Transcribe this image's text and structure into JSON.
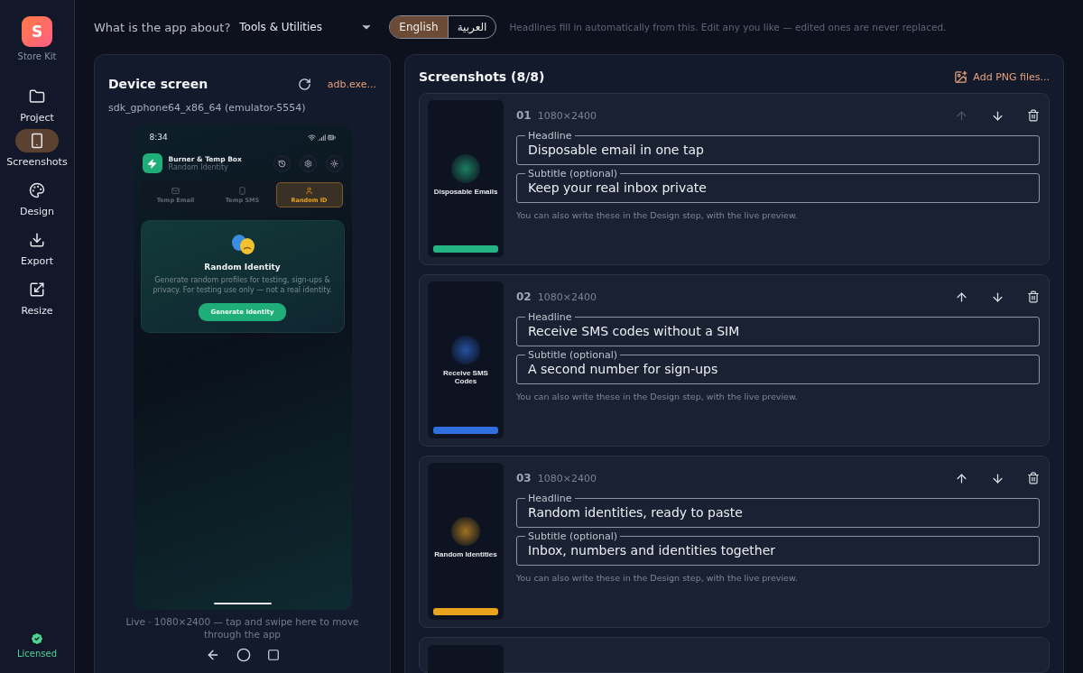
{
  "sidebar": {
    "logo_letter": "S",
    "app_name": "Store Kit",
    "items": [
      {
        "label": "Project",
        "selected": false
      },
      {
        "label": "Screenshots",
        "selected": true
      },
      {
        "label": "Design",
        "selected": false
      },
      {
        "label": "Export",
        "selected": false
      },
      {
        "label": "Resize",
        "selected": false
      }
    ],
    "license": "Licensed"
  },
  "topbar": {
    "question": "What is the app about?",
    "category": "Tools & Utilities",
    "languages": [
      {
        "label": "English",
        "selected": true
      },
      {
        "label": "العربية",
        "selected": false
      }
    ],
    "hint": "Headlines fill in automatically from this. Edit any you like — edited ones are never replaced."
  },
  "device": {
    "title": "Device screen",
    "adb": "adb.exe...",
    "device_name": "sdk_gphone64_x86_64 (emulator-5554)",
    "phone": {
      "time": "8:34",
      "app_title": "Burner & Temp Box",
      "app_subtitle": "Random Identity",
      "tabs": [
        {
          "label": "Temp Email",
          "selected": false
        },
        {
          "label": "Temp SMS",
          "selected": false
        },
        {
          "label": "Random ID",
          "selected": true
        }
      ],
      "card_title": "Random Identity",
      "card_text": "Generate random profiles for testing, sign-ups & privacy. For testing use only — not a real identity.",
      "card_button": "Generate Identity"
    },
    "caption": "Live · 1080×2400 — tap and swipe here to move through the app"
  },
  "screenshots": {
    "title": "Screenshots (8/8)",
    "add_button": "Add PNG files...",
    "items": [
      {
        "number": "01",
        "size": "1080×2400",
        "thumb_title": "Disposable Emails",
        "up_disabled": true,
        "headline_label": "Headline",
        "headline": "Disposable email in one tap",
        "subtitle_label": "Subtitle (optional)",
        "subtitle": "Keep your real inbox private",
        "note": "You can also write these in the Design step, with the live preview."
      },
      {
        "number": "02",
        "size": "1080×2400",
        "thumb_title": "Receive SMS Codes",
        "up_disabled": false,
        "headline_label": "Headline",
        "headline": "Receive SMS codes without a SIM",
        "subtitle_label": "Subtitle (optional)",
        "subtitle": "A second number for sign-ups",
        "note": "You can also write these in the Design step, with the live preview."
      },
      {
        "number": "03",
        "size": "1080×2400",
        "thumb_title": "Random Identities",
        "up_disabled": false,
        "headline_label": "Headline",
        "headline": "Random identities, ready to paste",
        "subtitle_label": "Subtitle (optional)",
        "subtitle": "Inbox, numbers and identities together",
        "note": "You can also write these in the Design step, with the live preview."
      }
    ]
  }
}
